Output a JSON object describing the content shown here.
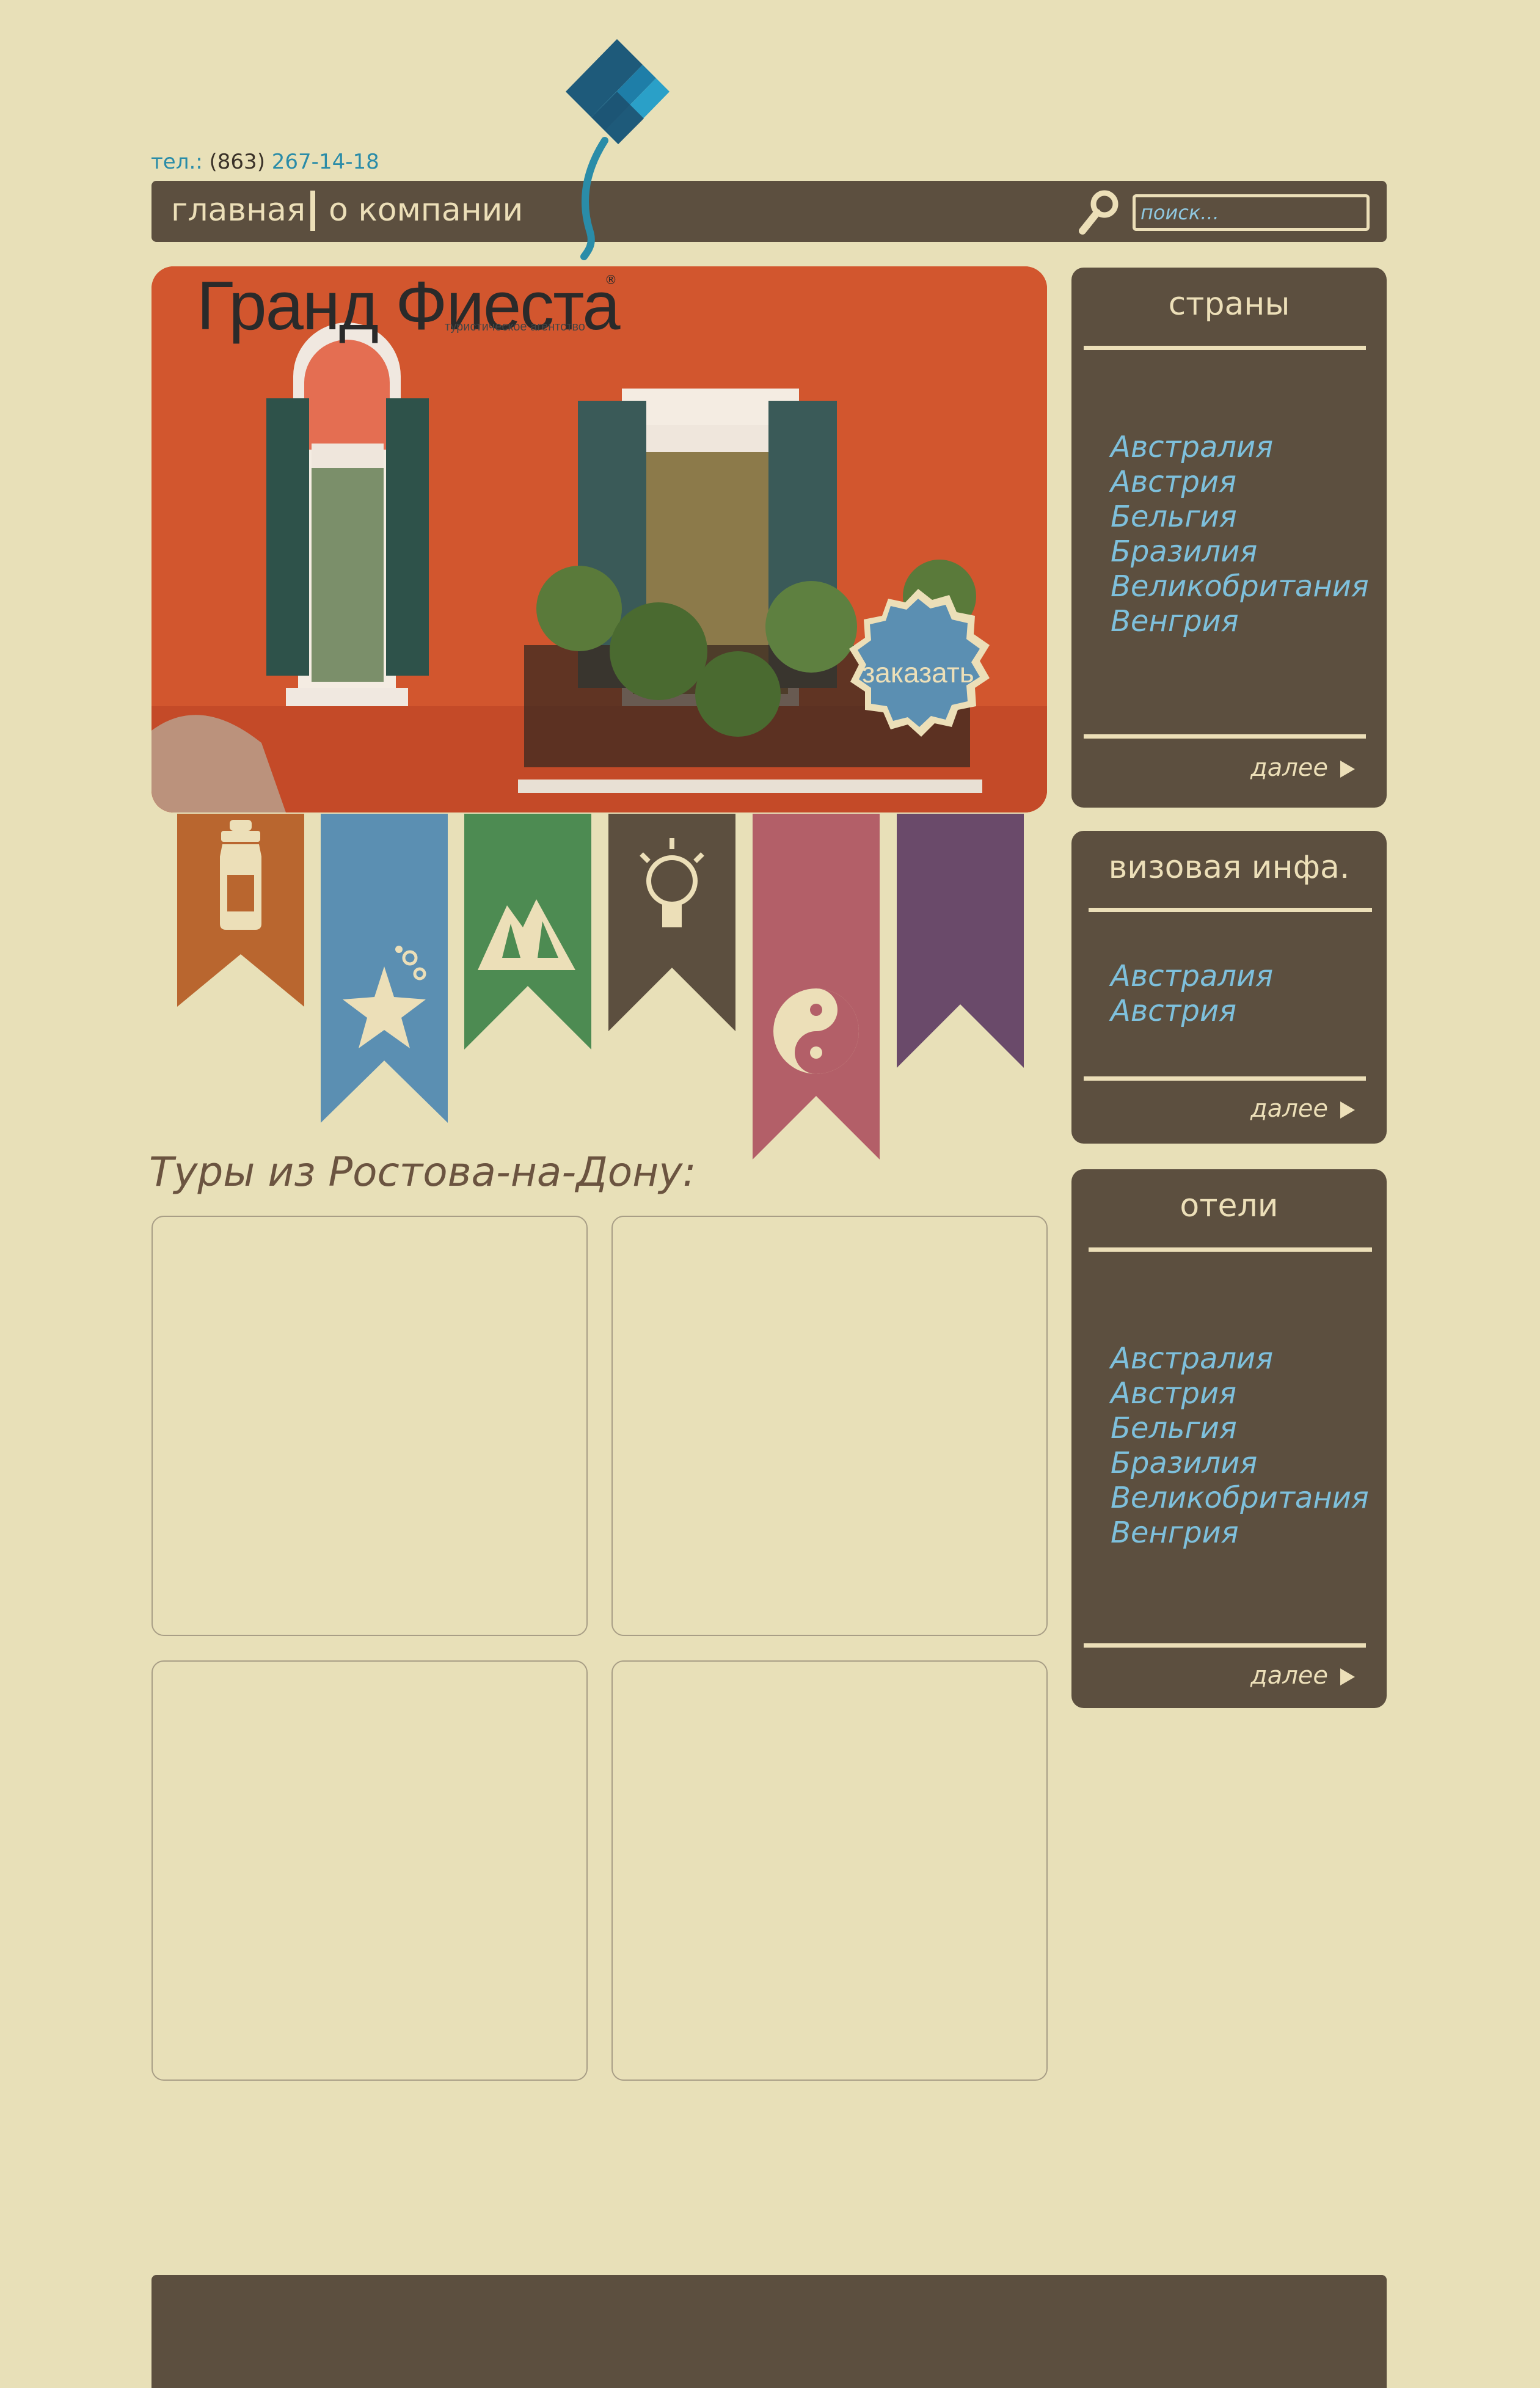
{
  "header": {
    "phone_label": "тел.:",
    "phone_code": "(863)",
    "phone_number": "267-14-18"
  },
  "nav": {
    "items": [
      {
        "label": "главная"
      },
      {
        "label": "о компании"
      }
    ],
    "search_placeholder": "поиск..."
  },
  "hero": {
    "brand_name": "Гранд Фиеста",
    "brand_tagline": "туристическое агентство",
    "brand_mark": "®",
    "order_button": "заказать"
  },
  "ribbons": [
    {
      "icon": "baby-bottle-icon",
      "color": "#b9662f"
    },
    {
      "icon": "starfish-icon",
      "color": "#5b8fb2"
    },
    {
      "icon": "mountain-icon",
      "color": "#4d8b52"
    },
    {
      "icon": "lightbulb-icon",
      "color": "#5c4f3f"
    },
    {
      "icon": "yin-yang-icon",
      "color": "#b35f68"
    },
    {
      "icon": "blank-icon",
      "color": "#6a4a6a"
    }
  ],
  "tours": {
    "title": "Туры из Ростова-на-Дону:"
  },
  "sidebar": {
    "countries": {
      "title": "страны",
      "items": [
        "Австралия",
        "Австрия",
        "Бельгия",
        "Бразилия",
        "Великобритания",
        "Венгрия"
      ],
      "more": "далее"
    },
    "visa": {
      "title": "визовая инфа.",
      "items": [
        "Австралия",
        "Австрия"
      ],
      "more": "далее"
    },
    "hotels": {
      "title": "отели",
      "items": [
        "Австралия",
        "Австрия",
        "Бельгия",
        "Бразилия",
        "Великобритания",
        "Венгрия"
      ],
      "more": "далее"
    }
  },
  "colors": {
    "background": "#e8e0b8",
    "panel": "#5c4f3f",
    "panel_text": "#ecdfb8",
    "link": "#7ec0dc",
    "accent": "#2a8ca8"
  }
}
